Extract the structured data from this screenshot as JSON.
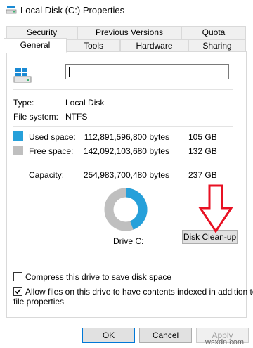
{
  "window": {
    "title": "Local Disk (C:) Properties"
  },
  "tabs": {
    "row1": [
      "Security",
      "Previous Versions",
      "Quota"
    ],
    "row2": [
      "General",
      "Tools",
      "Hardware",
      "Sharing"
    ]
  },
  "general": {
    "name_value": "",
    "type_label": "Type:",
    "type_value": "Local Disk",
    "fs_label": "File system:",
    "fs_value": "NTFS",
    "used": {
      "label": "Used space:",
      "bytes": "112,891,596,800 bytes",
      "size": "105 GB",
      "color": "#26a0da"
    },
    "free": {
      "label": "Free space:",
      "bytes": "142,092,103,680 bytes",
      "size": "132 GB",
      "color": "#bfbfbf"
    },
    "capacity": {
      "label": "Capacity:",
      "bytes": "254,983,700,480 bytes",
      "size": "237 GB"
    },
    "drive_label": "Drive C:",
    "cleanup_label": "Disk Clean-up",
    "used_fraction": 0.443
  },
  "options": {
    "compress_label": "Compress this drive to save disk space",
    "compress_checked": false,
    "index_label_1": "Allow files on this drive to have contents indexed in addition to",
    "index_label_2": "file properties",
    "index_checked": true
  },
  "buttons": {
    "ok": "OK",
    "cancel": "Cancel",
    "apply": "Apply"
  },
  "watermark": "wsxdn.com",
  "annotation": {
    "color": "#e81123"
  }
}
